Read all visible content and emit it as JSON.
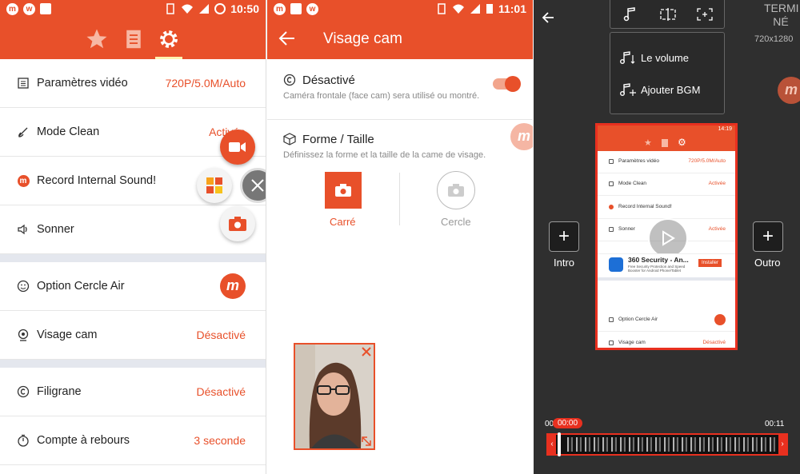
{
  "panel1": {
    "status": {
      "time": "10:50"
    },
    "tabs": [
      "star-icon",
      "list-icon",
      "gear-icon"
    ],
    "settings": [
      {
        "label": "Paramètres vidéo",
        "value": "720P/5.0M/Auto",
        "icon": "video-settings-icon"
      },
      {
        "label": "Mode Clean",
        "value": "Activée",
        "icon": "clean-icon"
      },
      {
        "label": "Record Internal Sound!",
        "value": "",
        "icon": "mobizen-icon"
      },
      {
        "label": "Sonner",
        "value": "Ac",
        "icon": "speaker-icon"
      },
      {
        "label": "Option Cercle Air",
        "value": "",
        "icon": "smiley-icon"
      },
      {
        "label": "Visage cam",
        "value": "Désactivé",
        "icon": "face-cam-icon"
      },
      {
        "label": "Filigrane",
        "value": "Désactivé",
        "icon": "copyright-icon"
      },
      {
        "label": "Compte à rebours",
        "value": "3 seconde",
        "icon": "timer-icon"
      }
    ]
  },
  "panel2": {
    "status": {
      "time": "11:01"
    },
    "title": "Visage cam",
    "option1": {
      "title": "Désactivé",
      "subtitle": "Caméra frontale (face cam) sera utilisé ou montré."
    },
    "option2": {
      "title": "Forme / Taille",
      "subtitle": "Définissez la forme et la taille de la came de visage."
    },
    "shapes": {
      "square": "Carré",
      "circle": "Cercle"
    }
  },
  "panel3": {
    "top_right": {
      "done": "TERMI\nNÉ",
      "resolution": "720x1280"
    },
    "menu": {
      "volume": "Le volume",
      "bgm": "Ajouter BGM"
    },
    "intro": "Intro",
    "outro": "Outro",
    "timeline": {
      "current": "00:00",
      "start": "00",
      "end": "00:11"
    },
    "preview": {
      "time": "14:19",
      "rows": [
        {
          "label": "Paramètres vidéo",
          "value": "720P/5.0M/Auto"
        },
        {
          "label": "Mode Clean",
          "value": "Activée"
        },
        {
          "label": "Record Internal Sound!",
          "value": ""
        },
        {
          "label": "Sonner",
          "value": "Activée"
        },
        {
          "label": "Option Cercle Air",
          "value": ""
        },
        {
          "label": "Visage cam",
          "value": "Désactivé"
        },
        {
          "label": "Filigrane",
          "value": "Désactivé"
        }
      ],
      "ad": {
        "title": "360 Security - An...",
        "desc": "Free Security Protection and Speed Booster for Android Phone/Tablet",
        "button": "Installer"
      }
    }
  },
  "colors": {
    "accent": "#e8502a",
    "dark": "#2f2f2f"
  }
}
